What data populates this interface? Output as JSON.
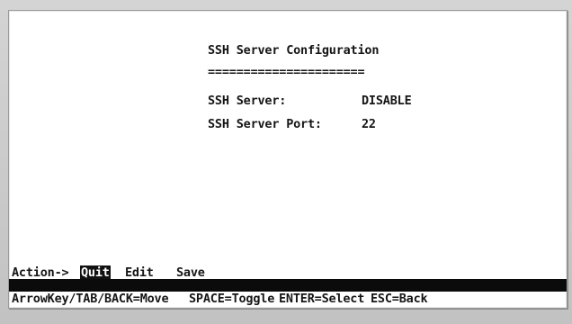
{
  "window": {
    "title": "SSH Server Configuration",
    "separator": "======================"
  },
  "fields": [
    {
      "label": "SSH Server:",
      "value": "DISABLE"
    },
    {
      "label": "SSH Server Port:",
      "value": "22"
    }
  ],
  "action_menu": {
    "prefix": "Action->",
    "items": [
      "Quit",
      "Edit",
      "Save"
    ],
    "selected": "Quit"
  },
  "help_bar": {
    "items": [
      "ArrowKey/TAB/BACK=Move",
      "SPACE=Toggle",
      "ENTER=Select",
      "ESC=Back"
    ]
  }
}
